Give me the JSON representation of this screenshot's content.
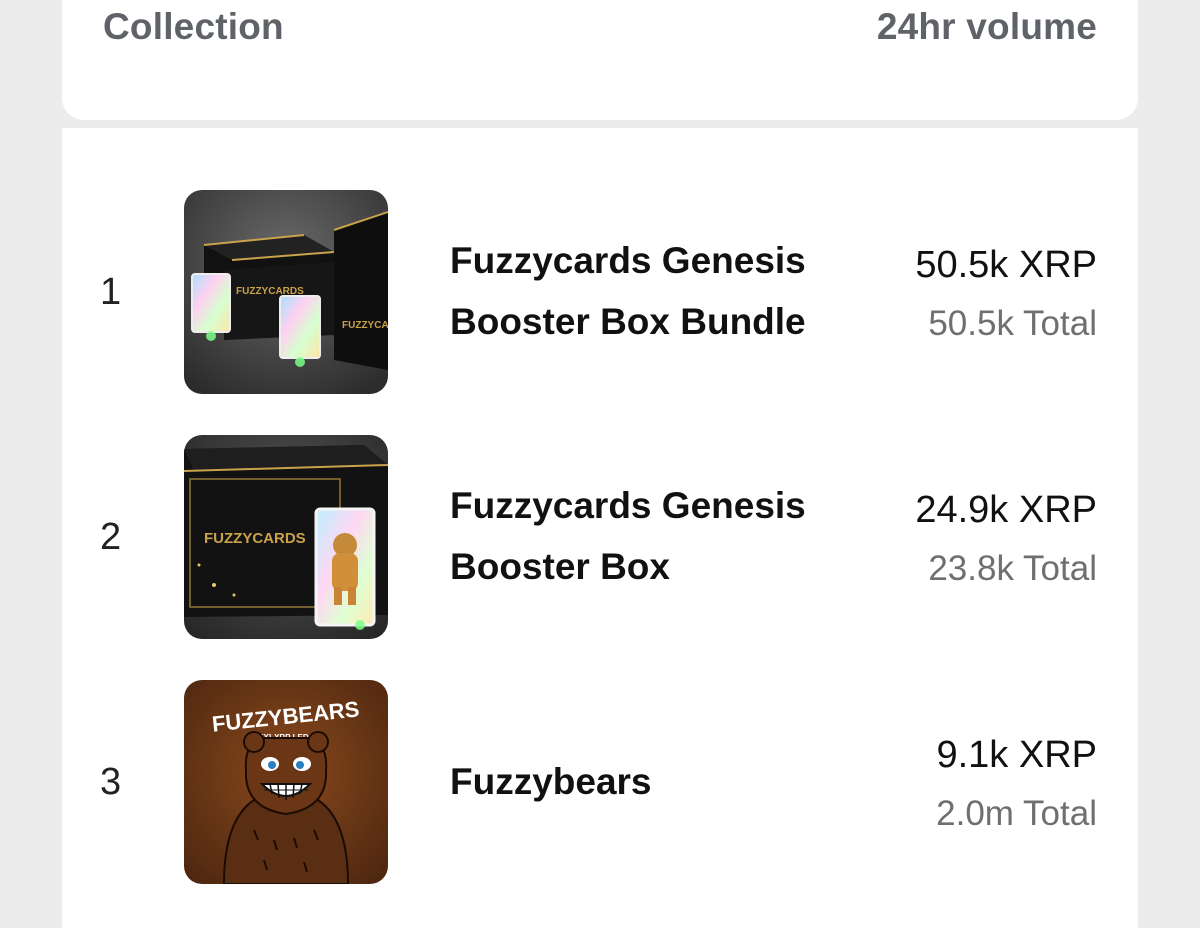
{
  "header": {
    "collection_label": "Collection",
    "volume_label": "24hr volume"
  },
  "rows": [
    {
      "rank": "1",
      "name_line1": "Fuzzycards Genesis",
      "name_line2": "Booster Box Bundle",
      "volume": "50.5k XRP",
      "total": "50.5k Total",
      "thumb_text": "FUZZYCARDS"
    },
    {
      "rank": "2",
      "name_line1": "Fuzzycards Genesis",
      "name_line2": "Booster Box",
      "volume": "24.9k XRP",
      "total": "23.8k Total",
      "thumb_text": "FUZZYCARDS"
    },
    {
      "rank": "3",
      "name_line1": "Fuzzybears",
      "volume": "9.1k XRP",
      "total": "2.0m Total",
      "thumb_text": "FUZZYBEARS",
      "thumb_subtext": "ON {X} XRP LEDGER"
    }
  ],
  "colors": {
    "page_bg": "#ececec",
    "card_bg": "#ffffff",
    "header_text": "#5f6368",
    "total_text": "#6f6f6f"
  }
}
